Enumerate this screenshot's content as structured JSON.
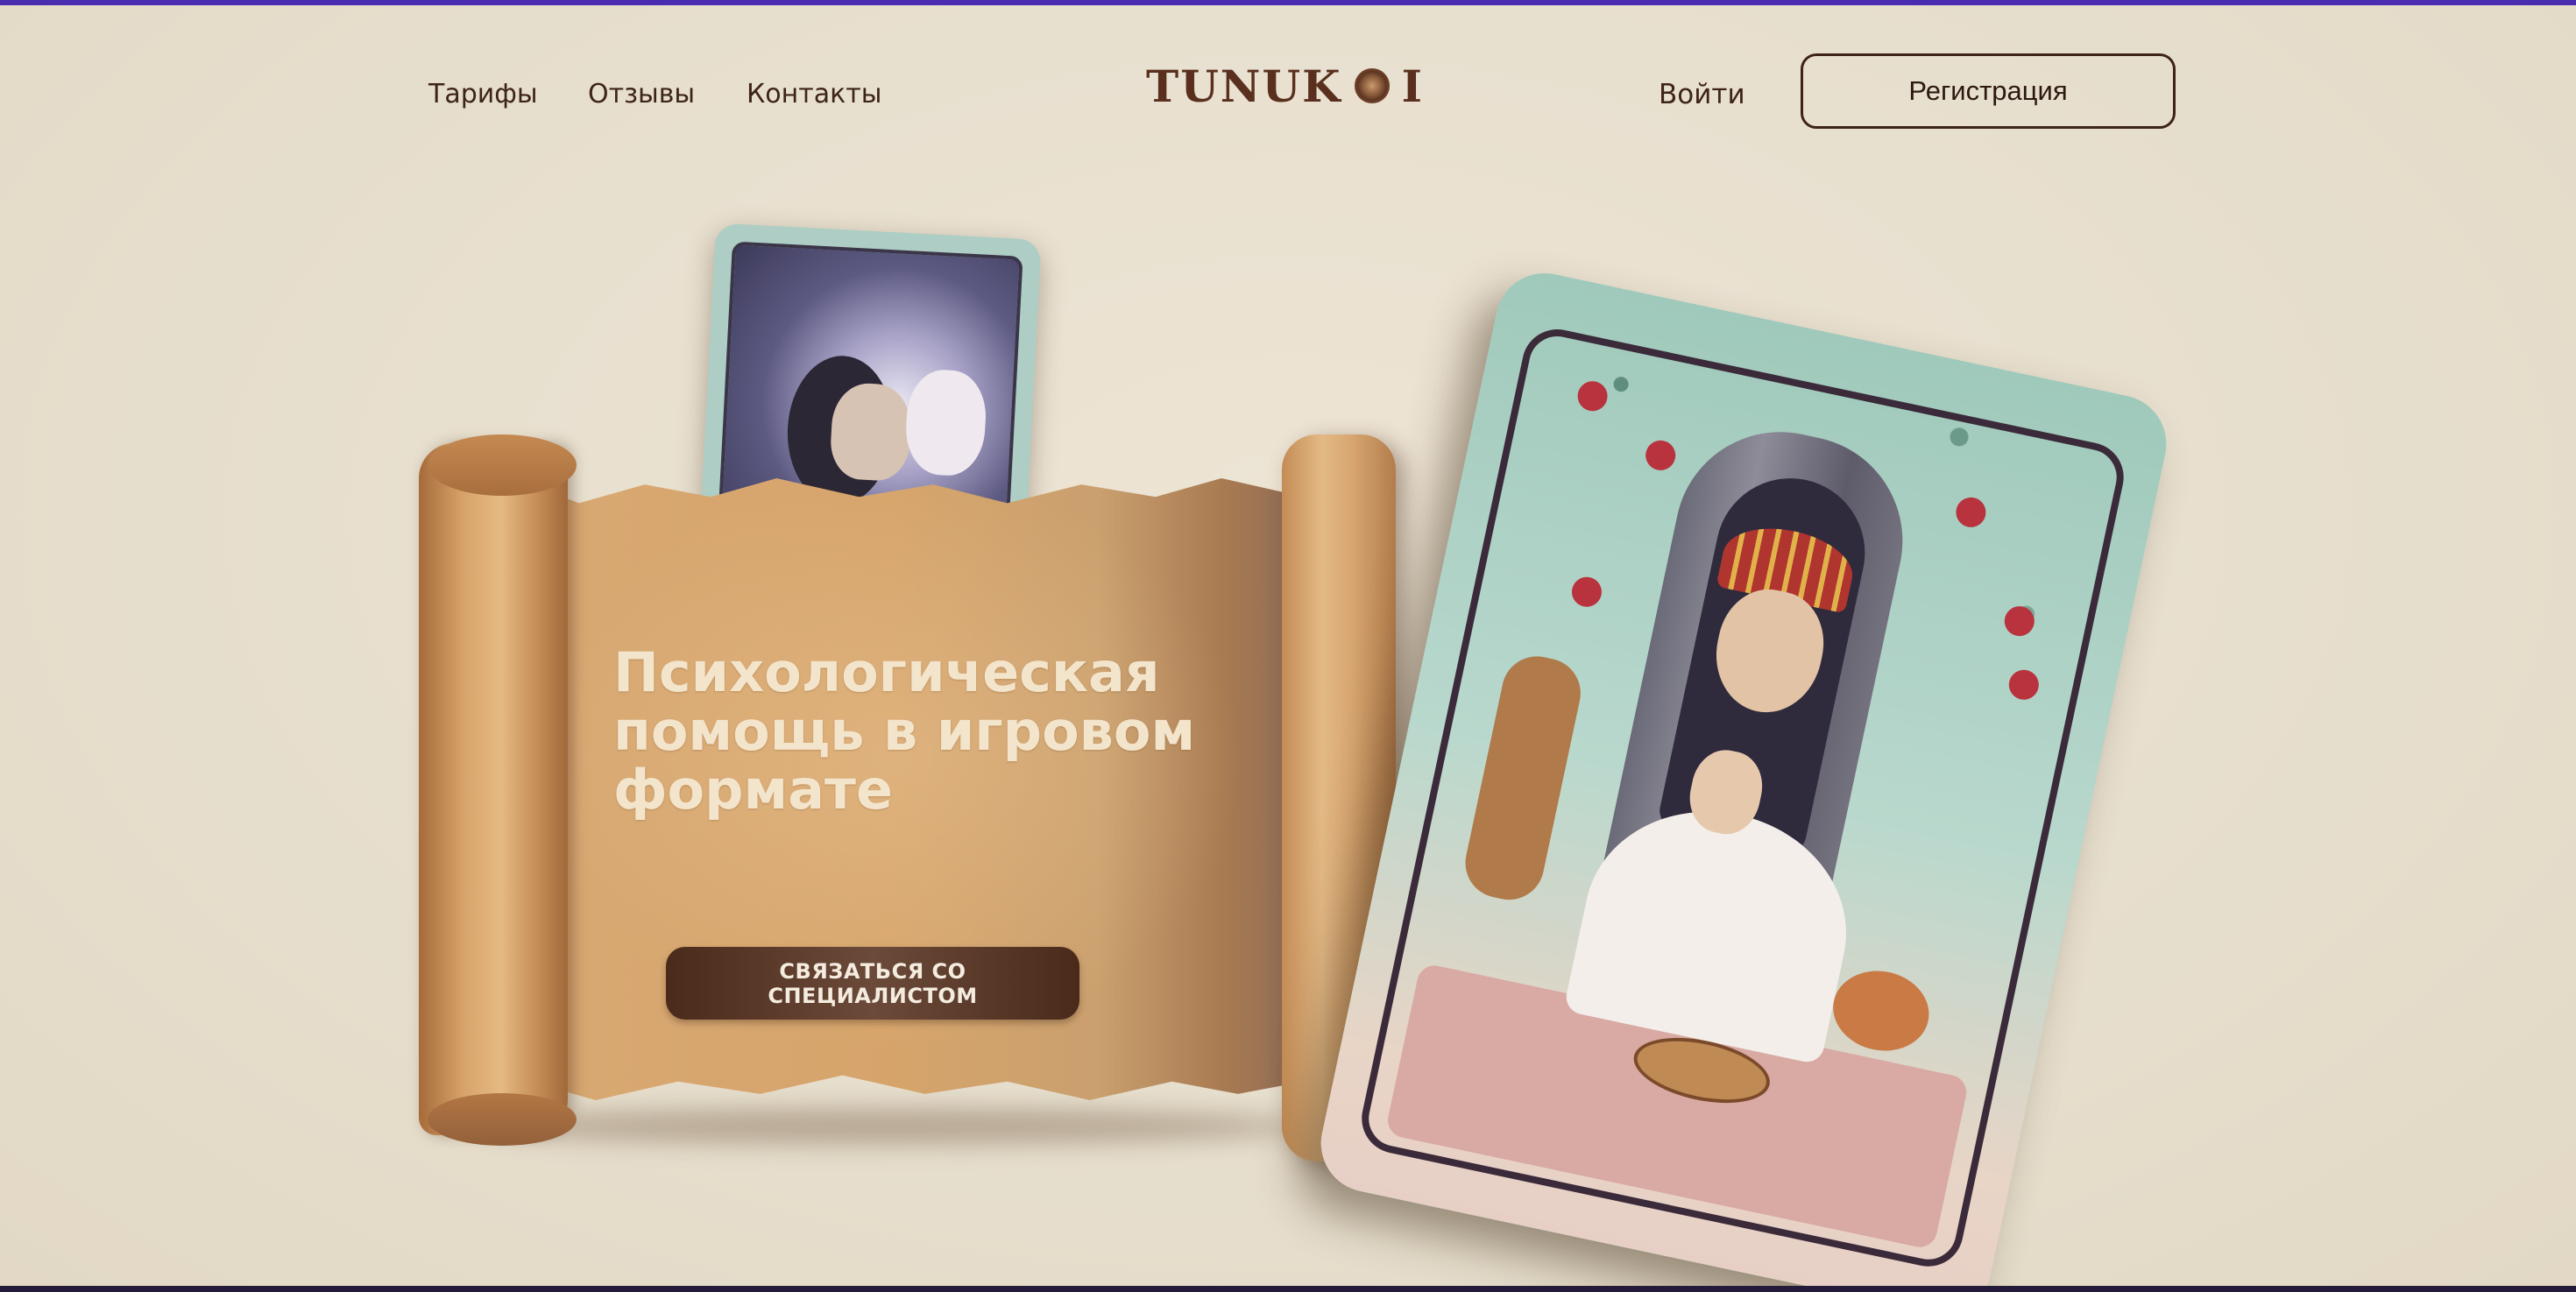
{
  "header": {
    "nav": [
      "Тарифы",
      "Отзывы",
      "Контакты"
    ],
    "logo_text_left": "TUNUK",
    "logo_text_right": "I",
    "logo_icon": "circular-emblem-icon",
    "login_label": "Войти",
    "register_label": "Регистрация"
  },
  "hero": {
    "headline": "Психологическая помощь в игровом формате",
    "cta_label": "СВЯЗАТЬСЯ СО СПЕЦИАЛИСТОМ"
  },
  "colors": {
    "background": "#e7dfce",
    "text_dark": "#3d2417",
    "headline": "#f3e4cc",
    "cta_bg": "#4a2a1a",
    "accent_top_bar": "#4a2cb0"
  }
}
